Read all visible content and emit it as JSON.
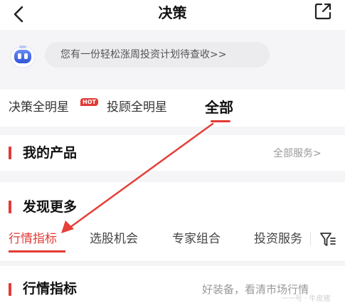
{
  "header": {
    "title": "决策"
  },
  "promo": {
    "text": "您有一份轻松涨周投资计划待查收>>"
  },
  "top_tabs": [
    {
      "label": "决策全明星",
      "badge": "HOT"
    },
    {
      "label": "投顾全明星"
    },
    {
      "label": "全部",
      "active": true
    }
  ],
  "my_products": {
    "title": "我的产品",
    "link": "全部服务>"
  },
  "discover": {
    "title": "发现更多",
    "tabs": [
      {
        "label": "行情指标",
        "active": true
      },
      {
        "label": "选股机会"
      },
      {
        "label": "专家组合"
      },
      {
        "label": "投资服务"
      }
    ]
  },
  "indicators": {
    "title": "行情指标",
    "subtitle": "好装备，看清市场行情"
  },
  "colors": {
    "accent": "#e23b36",
    "annotation_arrow": "#e5403a"
  },
  "icons": [
    "back-arrow-icon",
    "share-icon",
    "robot-avatar-icon",
    "filter-icon"
  ],
  "watermark": "一一号 · 牛皮猪"
}
